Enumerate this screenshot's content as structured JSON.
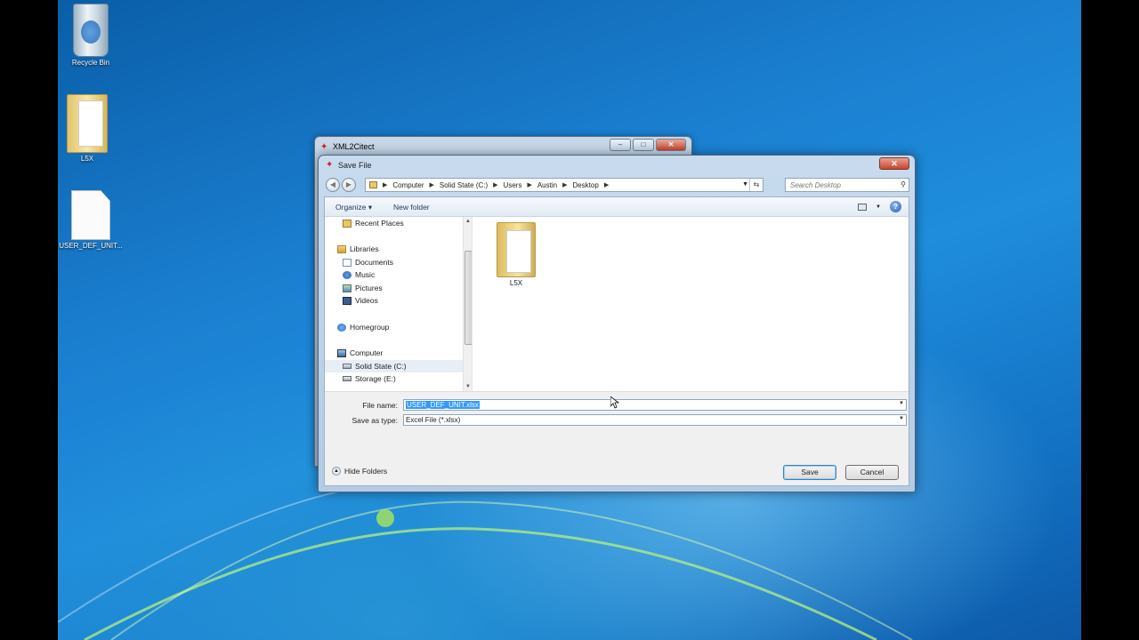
{
  "desktop": {
    "icons": [
      {
        "label": "Recycle Bin",
        "icon": "recycle-bin-icon"
      },
      {
        "label": "L5X",
        "icon": "folder-icon"
      },
      {
        "label": "USER_DEF_UNIT...",
        "icon": "excel-file-icon"
      }
    ]
  },
  "background_window": {
    "title": "XML2Citect",
    "min": "–",
    "max": "□",
    "close": "✕"
  },
  "dialog": {
    "title": "Save File",
    "close": "✕",
    "breadcrumb": [
      "Computer",
      "Solid State (C:)",
      "Users",
      "Austin",
      "Desktop"
    ],
    "search_placeholder": "Search Desktop",
    "toolbar": {
      "organize": "Organize ▾",
      "new_folder": "New folder",
      "help": "?"
    },
    "nav": [
      {
        "label": "Recent Places",
        "icon": "recent-places-icon"
      },
      {
        "label": "Libraries",
        "icon": "libraries-icon"
      },
      {
        "label": "Documents",
        "icon": "documents-icon"
      },
      {
        "label": "Music",
        "icon": "music-icon"
      },
      {
        "label": "Pictures",
        "icon": "pictures-icon"
      },
      {
        "label": "Videos",
        "icon": "videos-icon"
      },
      {
        "label": "Homegroup",
        "icon": "homegroup-icon"
      },
      {
        "label": "Computer",
        "icon": "computer-icon"
      },
      {
        "label": "Solid State (C:)",
        "icon": "drive-icon",
        "selected": true
      },
      {
        "label": "Storage (E:)",
        "icon": "drive-icon"
      }
    ],
    "files": [
      {
        "label": "L5X",
        "icon": "folder-icon"
      }
    ],
    "file_name_label": "File name:",
    "file_name_value": "USER_DEF_UNIT.xlsx",
    "save_type_label": "Save as type:",
    "save_type_value": "Excel File (*.xlsx)",
    "hide_folders": "Hide Folders",
    "save_button": "Save",
    "cancel_button": "Cancel"
  }
}
